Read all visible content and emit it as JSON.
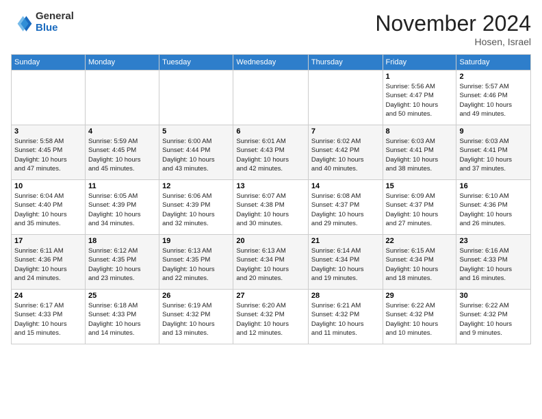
{
  "header": {
    "logo_general": "General",
    "logo_blue": "Blue",
    "month": "November 2024",
    "location": "Hosen, Israel"
  },
  "weekdays": [
    "Sunday",
    "Monday",
    "Tuesday",
    "Wednesday",
    "Thursday",
    "Friday",
    "Saturday"
  ],
  "weeks": [
    [
      {
        "day": "",
        "info": ""
      },
      {
        "day": "",
        "info": ""
      },
      {
        "day": "",
        "info": ""
      },
      {
        "day": "",
        "info": ""
      },
      {
        "day": "",
        "info": ""
      },
      {
        "day": "1",
        "info": "Sunrise: 5:56 AM\nSunset: 4:47 PM\nDaylight: 10 hours\nand 50 minutes."
      },
      {
        "day": "2",
        "info": "Sunrise: 5:57 AM\nSunset: 4:46 PM\nDaylight: 10 hours\nand 49 minutes."
      }
    ],
    [
      {
        "day": "3",
        "info": "Sunrise: 5:58 AM\nSunset: 4:45 PM\nDaylight: 10 hours\nand 47 minutes."
      },
      {
        "day": "4",
        "info": "Sunrise: 5:59 AM\nSunset: 4:45 PM\nDaylight: 10 hours\nand 45 minutes."
      },
      {
        "day": "5",
        "info": "Sunrise: 6:00 AM\nSunset: 4:44 PM\nDaylight: 10 hours\nand 43 minutes."
      },
      {
        "day": "6",
        "info": "Sunrise: 6:01 AM\nSunset: 4:43 PM\nDaylight: 10 hours\nand 42 minutes."
      },
      {
        "day": "7",
        "info": "Sunrise: 6:02 AM\nSunset: 4:42 PM\nDaylight: 10 hours\nand 40 minutes."
      },
      {
        "day": "8",
        "info": "Sunrise: 6:03 AM\nSunset: 4:41 PM\nDaylight: 10 hours\nand 38 minutes."
      },
      {
        "day": "9",
        "info": "Sunrise: 6:03 AM\nSunset: 4:41 PM\nDaylight: 10 hours\nand 37 minutes."
      }
    ],
    [
      {
        "day": "10",
        "info": "Sunrise: 6:04 AM\nSunset: 4:40 PM\nDaylight: 10 hours\nand 35 minutes."
      },
      {
        "day": "11",
        "info": "Sunrise: 6:05 AM\nSunset: 4:39 PM\nDaylight: 10 hours\nand 34 minutes."
      },
      {
        "day": "12",
        "info": "Sunrise: 6:06 AM\nSunset: 4:39 PM\nDaylight: 10 hours\nand 32 minutes."
      },
      {
        "day": "13",
        "info": "Sunrise: 6:07 AM\nSunset: 4:38 PM\nDaylight: 10 hours\nand 30 minutes."
      },
      {
        "day": "14",
        "info": "Sunrise: 6:08 AM\nSunset: 4:37 PM\nDaylight: 10 hours\nand 29 minutes."
      },
      {
        "day": "15",
        "info": "Sunrise: 6:09 AM\nSunset: 4:37 PM\nDaylight: 10 hours\nand 27 minutes."
      },
      {
        "day": "16",
        "info": "Sunrise: 6:10 AM\nSunset: 4:36 PM\nDaylight: 10 hours\nand 26 minutes."
      }
    ],
    [
      {
        "day": "17",
        "info": "Sunrise: 6:11 AM\nSunset: 4:36 PM\nDaylight: 10 hours\nand 24 minutes."
      },
      {
        "day": "18",
        "info": "Sunrise: 6:12 AM\nSunset: 4:35 PM\nDaylight: 10 hours\nand 23 minutes."
      },
      {
        "day": "19",
        "info": "Sunrise: 6:13 AM\nSunset: 4:35 PM\nDaylight: 10 hours\nand 22 minutes."
      },
      {
        "day": "20",
        "info": "Sunrise: 6:13 AM\nSunset: 4:34 PM\nDaylight: 10 hours\nand 20 minutes."
      },
      {
        "day": "21",
        "info": "Sunrise: 6:14 AM\nSunset: 4:34 PM\nDaylight: 10 hours\nand 19 minutes."
      },
      {
        "day": "22",
        "info": "Sunrise: 6:15 AM\nSunset: 4:34 PM\nDaylight: 10 hours\nand 18 minutes."
      },
      {
        "day": "23",
        "info": "Sunrise: 6:16 AM\nSunset: 4:33 PM\nDaylight: 10 hours\nand 16 minutes."
      }
    ],
    [
      {
        "day": "24",
        "info": "Sunrise: 6:17 AM\nSunset: 4:33 PM\nDaylight: 10 hours\nand 15 minutes."
      },
      {
        "day": "25",
        "info": "Sunrise: 6:18 AM\nSunset: 4:33 PM\nDaylight: 10 hours\nand 14 minutes."
      },
      {
        "day": "26",
        "info": "Sunrise: 6:19 AM\nSunset: 4:32 PM\nDaylight: 10 hours\nand 13 minutes."
      },
      {
        "day": "27",
        "info": "Sunrise: 6:20 AM\nSunset: 4:32 PM\nDaylight: 10 hours\nand 12 minutes."
      },
      {
        "day": "28",
        "info": "Sunrise: 6:21 AM\nSunset: 4:32 PM\nDaylight: 10 hours\nand 11 minutes."
      },
      {
        "day": "29",
        "info": "Sunrise: 6:22 AM\nSunset: 4:32 PM\nDaylight: 10 hours\nand 10 minutes."
      },
      {
        "day": "30",
        "info": "Sunrise: 6:22 AM\nSunset: 4:32 PM\nDaylight: 10 hours\nand 9 minutes."
      }
    ]
  ]
}
